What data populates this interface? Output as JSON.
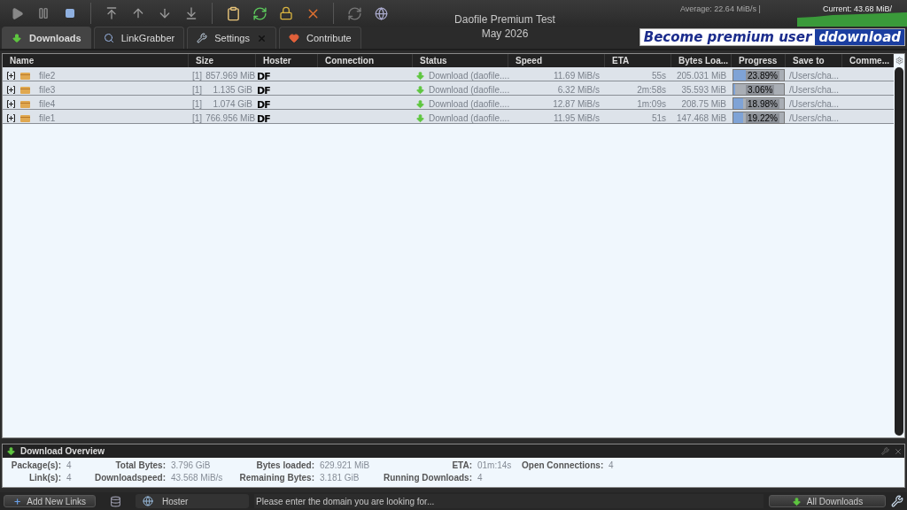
{
  "title": {
    "name": "Daofile Premium Test",
    "date": "May 2026"
  },
  "speed_meter": {
    "average": "Average: 22.64 MiB/s |",
    "current": "Current: 43.68 MiB/"
  },
  "tabs": [
    {
      "label": "Downloads",
      "selected": true,
      "closable": false
    },
    {
      "label": "LinkGrabber",
      "selected": false,
      "closable": false
    },
    {
      "label": "Settings",
      "selected": false,
      "closable": true
    },
    {
      "label": "Contribute",
      "selected": false,
      "closable": false
    }
  ],
  "banner": {
    "text": "Become premium user",
    "brand": "ddownload"
  },
  "table": {
    "columns": [
      "Name",
      "Size",
      "Hoster",
      "Connection",
      "Status",
      "Speed",
      "ETA",
      "Bytes Loa...",
      "Progress",
      "Save to",
      "Comme..."
    ],
    "rows": [
      {
        "expanded": false,
        "name": "file2",
        "count": "[1]",
        "size": "857.969 MiB",
        "hoster": "DF",
        "status": "Download (daofile....",
        "speed": "11.69 MiB/s",
        "eta": "55s",
        "bytes": "205.031 MiB",
        "level": 0.2389,
        "progress": "23.89%",
        "save_to": "/Users/cha..."
      },
      {
        "expanded": false,
        "name": "file3",
        "count": "[1]",
        "size": "1.135 GiB",
        "hoster": "DF",
        "status": "Download (daofile....",
        "speed": "6.32 MiB/s",
        "eta": "2m:58s",
        "bytes": "35.593 MiB",
        "level": 0.0306,
        "progress": "3.06%",
        "save_to": "/Users/cha..."
      },
      {
        "expanded": false,
        "name": "file4",
        "count": "[1]",
        "size": "1.074 GiB",
        "hoster": "DF",
        "status": "Download (daofile....",
        "speed": "12.87 MiB/s",
        "eta": "1m:09s",
        "bytes": "208.75 MiB",
        "level": 0.1898,
        "progress": "18.98%",
        "save_to": "/Users/cha..."
      },
      {
        "expanded": false,
        "name": "file1",
        "count": "[1]",
        "size": "766.956 MiB",
        "hoster": "DF",
        "status": "Download (daofile....",
        "speed": "11.95 MiB/s",
        "eta": "51s",
        "bytes": "147.468 MiB",
        "level": 0.1922,
        "progress": "19.22%",
        "save_to": "/Users/cha..."
      }
    ]
  },
  "overview": {
    "title": "Download Overview",
    "rows": [
      [
        {
          "label": "Package(s):",
          "value": "4"
        },
        {
          "label": "Total Bytes:",
          "value": "3.796 GiB"
        },
        {
          "label": "Bytes loaded:",
          "value": "629.921 MiB"
        },
        {
          "label": "ETA:",
          "value": "01m:14s"
        },
        {
          "label": "Open Connections:",
          "value": "4"
        }
      ],
      [
        {
          "label": "Link(s):",
          "value": "4"
        },
        {
          "label": "Downloadspeed:",
          "value": "43.568 MiB/s"
        },
        {
          "label": "Remaining Bytes:",
          "value": "3.181 GiB"
        },
        {
          "label": "Running Downloads:",
          "value": "4"
        }
      ]
    ]
  },
  "bottom_bar": {
    "add_button": "Add New Links",
    "filter": "Hoster",
    "search_placeholder": "Please enter the domain you are looking for...",
    "view_button": "All Downloads"
  }
}
